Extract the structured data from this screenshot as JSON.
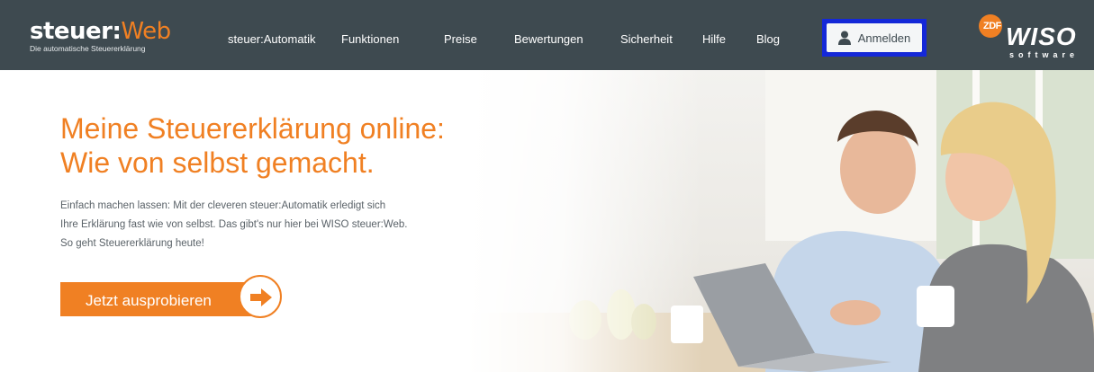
{
  "header": {
    "brand": {
      "name_part1": "steuer:",
      "name_part2": "Web",
      "tagline": "Die automatische Steuererklärung"
    },
    "nav_items": [
      {
        "label": "steuer:Automatik"
      },
      {
        "label": "Funktionen"
      },
      {
        "label": "Preise"
      },
      {
        "label": "Bewertungen"
      },
      {
        "label": "Sicherheit"
      },
      {
        "label": "Hilfe"
      },
      {
        "label": "Blog"
      }
    ],
    "login_label": "Anmelden",
    "login_icon": "user-icon",
    "logo": {
      "zdf": "ZDF",
      "wiso": "WISO",
      "software": "software"
    }
  },
  "hero": {
    "headline_line1": "Meine Steuererklärung online:",
    "headline_line2": "Wie von selbst gemacht.",
    "intro_line1": "Einfach machen lassen: Mit der cleveren steuer:Automatik erledigt sich",
    "intro_line2": "Ihre Erklärung fast wie von selbst. Das gibt's nur hier bei WISO steuer:Web.",
    "intro_line3": "So geht Steuererklärung heute!",
    "cta_label": "Jetzt ausprobieren",
    "cta_icon": "arrow-right-icon"
  },
  "colors": {
    "nav_bg": "#3e4a50",
    "accent": "#f08023",
    "highlight_frame": "#1428d8",
    "body_text": "#5a6268"
  }
}
